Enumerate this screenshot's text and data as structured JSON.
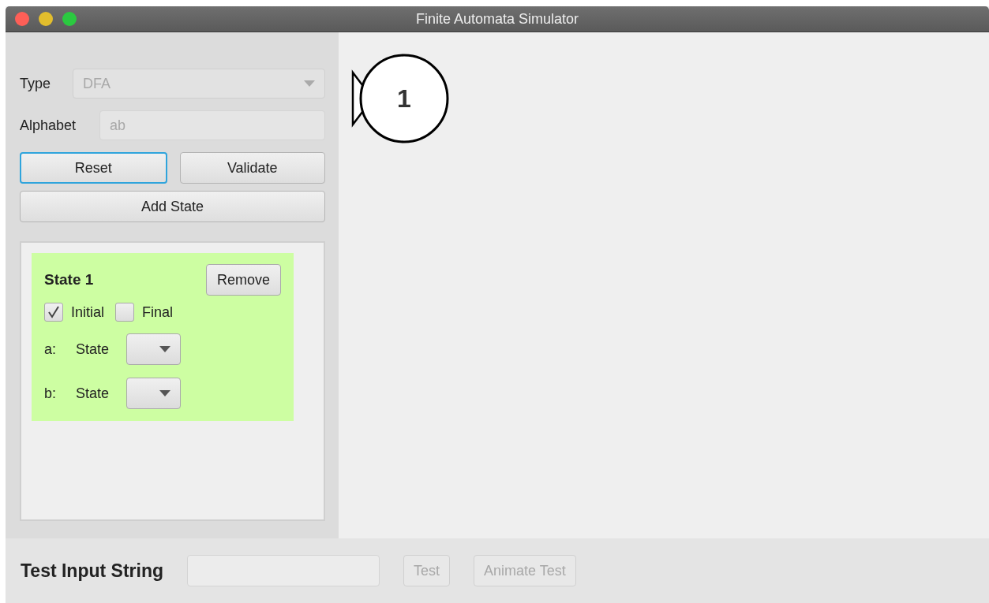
{
  "window": {
    "title": "Finite Automata Simulator"
  },
  "settings": {
    "type_label": "Type",
    "type_value": "DFA",
    "type_disabled": true,
    "alphabet_label": "Alphabet",
    "alphabet_value": "ab",
    "alphabet_disabled": true
  },
  "buttons": [
    {
      "label": "Reset",
      "focused": true
    },
    {
      "label": "Validate",
      "focused": false
    }
  ],
  "add_state_button": "Add State",
  "states": [
    {
      "title": "State 1",
      "remove_label": "Remove",
      "initial_label": "Initial",
      "initial": true,
      "final_label": "Final",
      "final": false,
      "transitions": [
        {
          "symbol": "a:",
          "label": "State"
        },
        {
          "symbol": "b:",
          "label": "State"
        }
      ]
    }
  ],
  "canvas": {
    "nodes": [
      {
        "label": "1",
        "initial": true,
        "final": false
      }
    ]
  },
  "test_bar": {
    "label": "Test Input String",
    "test_button": "Test",
    "test_disabled": true,
    "animate_button": "Animate Test",
    "animate_disabled": true
  }
}
